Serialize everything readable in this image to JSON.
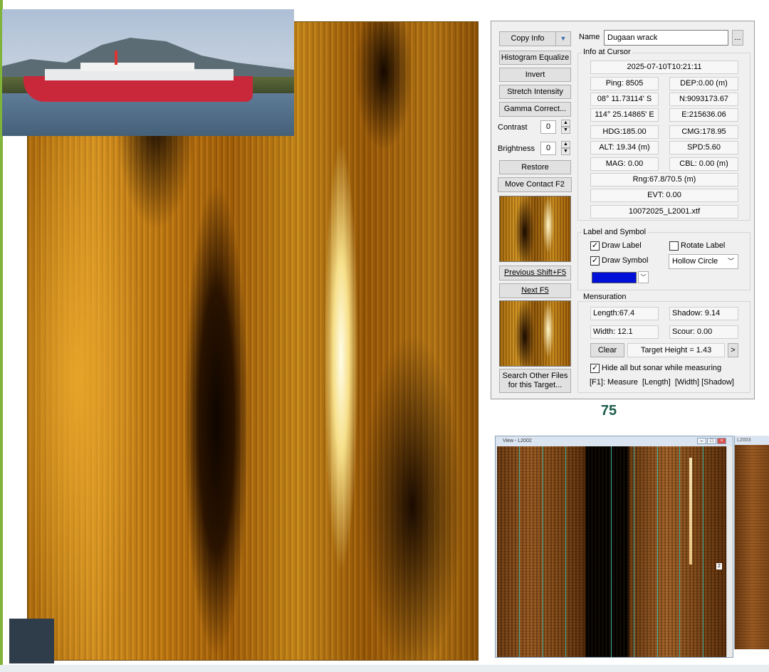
{
  "panel": {
    "copy_info": "Copy Info",
    "histogram_equalize": "Histogram Equalize",
    "invert": "Invert",
    "stretch_intensity": "Stretch Intensity",
    "gamma_correct": "Gamma Correct...",
    "contrast_label": "Contrast",
    "contrast_value": "0",
    "brightness_label": "Brightness",
    "brightness_value": "0",
    "restore": "Restore",
    "move_contact": "Move Contact F2",
    "previous": "Previous Shift+F5",
    "next": "Next F5",
    "search_other_line1": "Search Other Files",
    "search_other_line2": "for this Target...",
    "name_label": "Name",
    "name_value": "Dugaan wrack",
    "name_browse": "...",
    "info_at_cursor": {
      "title": "Info at Cursor",
      "timestamp": "2025-07-10T10:21:11",
      "ping": "Ping: 8505",
      "dep": "DEP:0.00 (m)",
      "lat": "08° 11.73114' S",
      "northing": "N:9093173.67",
      "lon": "114° 25.14865' E",
      "easting": "E:215636.06",
      "hdg": "HDG:185.00",
      "cmg": "CMG:178.95",
      "alt": "ALT: 19.34 (m)",
      "spd": "SPD:5.60",
      "mag": "MAG: 0.00",
      "cbl": "CBL: 0.00 (m)",
      "rng": "Rng:67.8/70.5 (m)",
      "evt": "EVT: 0.00",
      "file": "10072025_L2001.xtf"
    },
    "label_symbol": {
      "title": "Label and Symbol",
      "draw_label": "Draw Label",
      "draw_label_checked": true,
      "rotate_label": "Rotate Label",
      "rotate_label_checked": false,
      "draw_symbol": "Draw Symbol",
      "draw_symbol_checked": true,
      "symbol_type": "Hollow Circle",
      "symbol_color": "#0010d8"
    },
    "mensuration": {
      "title": "Mensuration",
      "length": "Length:67.4",
      "shadow": "Shadow: 9.14",
      "width": "Width: 12.1",
      "scour": "Scour: 0.00",
      "clear": "Clear",
      "target_height": "Target Height = 1.43",
      "arrow": ">",
      "hide_all": "Hide all but sonar while measuring",
      "hide_all_checked": true,
      "shortcut_help": "[F1]: Measure  [Length]  [Width] [Shadow]"
    }
  },
  "page_number": "75",
  "view_window": {
    "title": "View - L2002",
    "marker": "2"
  },
  "view_window2": {
    "title": "L2003"
  },
  "colors": {
    "accent_green": "#7fb33a",
    "page_number_color": "#1c5c4c"
  }
}
